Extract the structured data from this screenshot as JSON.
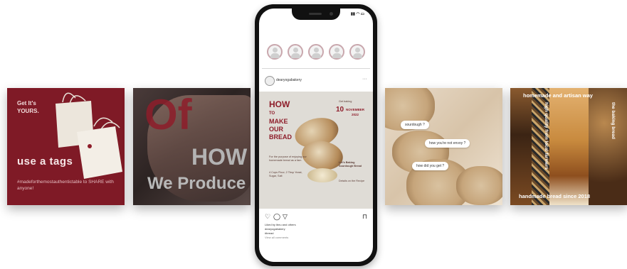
{
  "tile1": {
    "headline": "Get It's YOURS.",
    "cta": "use a tags",
    "hashtag_line": "#madeforthemostauthentictable to SHARE with anyone!",
    "bg": "#7f1a26"
  },
  "tile2": {
    "word_of": "Of",
    "word_how": "HOW",
    "word_produce": "We Produce"
  },
  "tile4": {
    "bubble1": "sourdough ?",
    "bubble2": "how you're not envoy ?",
    "bubble3": "how did you get ?"
  },
  "tile5": {
    "top_line": "homemade and artisan way",
    "bottom_line": "handmade bread since 2018",
    "side_left": "high quality from local farmers",
    "side_right": "the baking bread"
  },
  "phone": {
    "status_time": "",
    "username": "dearyogabakery",
    "more_icon": "more-dots-icon",
    "post": {
      "title": [
        "HOW",
        "TO",
        "MAKE",
        "OUR",
        "BREAD"
      ],
      "date_day": "10",
      "date_month": "NOVEMBER",
      "date_year": "2022",
      "date_caption": "Get baking",
      "body": "For the purpose of enjoying our homemade bread as a fam",
      "subtitle": "Let's Baking Sourdough Bread",
      "ingredients": "4 Cups Flour, 2 Tbsp Yeast, Sugar, Salt",
      "notes": "Details on the Recipe"
    },
    "likes": "Liked by ibnu and others",
    "caption": "dearyogabakery",
    "caption2": "#bread",
    "comments": "View all comments"
  },
  "colors": {
    "accent": "#8e1d2a",
    "post_bg": "#dfdcd6"
  }
}
